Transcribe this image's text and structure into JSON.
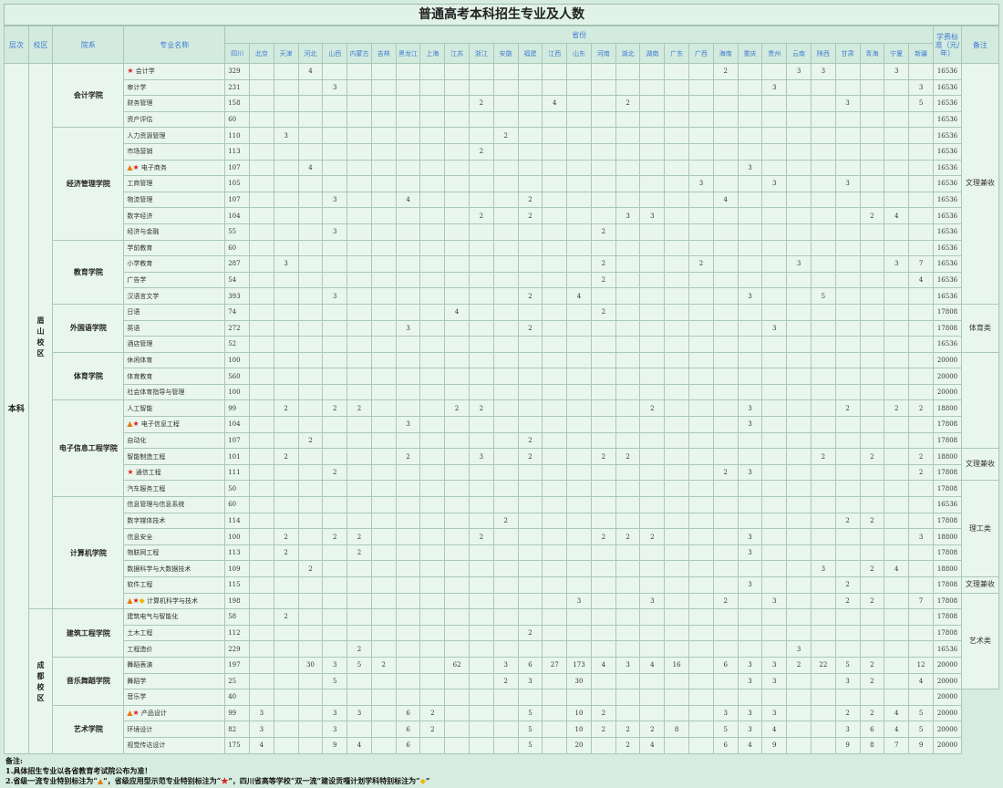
{
  "title": "普通高考本科招生专业及人数",
  "headers": {
    "level": "层次",
    "campus": "校区",
    "college": "院系",
    "major": "专业名称",
    "provinces_group": "省份",
    "fee": "学费标准（元/年）",
    "note": "备注"
  },
  "provinces": [
    "四川",
    "北京",
    "天津",
    "河北",
    "山西",
    "内蒙古",
    "吉林",
    "黑龙江",
    "上海",
    "江苏",
    "浙江",
    "安徽",
    "福建",
    "江西",
    "山东",
    "河南",
    "湖北",
    "湖南",
    "广东",
    "广西",
    "海南",
    "重庆",
    "贵州",
    "云南",
    "陕西",
    "甘肃",
    "青海",
    "宁夏",
    "新疆"
  ],
  "level_value": "本科",
  "campuses": [
    "眉山校区",
    "成都校区"
  ],
  "legend_glyphs": {
    "star": "★",
    "triangle": "▲",
    "diamond": "◆"
  },
  "colleges": [
    {
      "name": "会计学院",
      "campus": 0,
      "majors": [
        {
          "name": "会计学",
          "badges": [
            "star"
          ],
          "counts": {
            "四川": "329",
            "河北": "4",
            "海南": "2",
            "云南": "3",
            "陕西": "3",
            "宁夏": "3"
          },
          "fee": "16536"
        },
        {
          "name": "审计学",
          "badges": [],
          "counts": {
            "四川": "231",
            "山西": "3",
            "贵州": "3",
            "新疆": "3"
          },
          "fee": "16536"
        },
        {
          "name": "财务管理",
          "badges": [],
          "counts": {
            "四川": "158",
            "浙江": "2",
            "江西": "4",
            "湖北": "2",
            "甘肃": "3",
            "新疆": "5"
          },
          "fee": "16536"
        },
        {
          "name": "资产评估",
          "badges": [],
          "counts": {
            "四川": "60"
          },
          "fee": "16536"
        }
      ]
    },
    {
      "name": "经济管理学院",
      "campus": 0,
      "majors": [
        {
          "name": "人力资源管理",
          "badges": [],
          "counts": {
            "四川": "110",
            "天津": "3",
            "安徽": "2"
          },
          "fee": "16536"
        },
        {
          "name": "市场营销",
          "badges": [],
          "counts": {
            "四川": "113",
            "浙江": "2"
          },
          "fee": "16536"
        },
        {
          "name": "电子商务",
          "badges": [
            "triangle",
            "star"
          ],
          "counts": {
            "四川": "107",
            "河北": "4",
            "重庆": "3"
          },
          "fee": "16536"
        },
        {
          "name": "工商管理",
          "badges": [],
          "counts": {
            "四川": "105",
            "广西": "3",
            "贵州": "3",
            "甘肃": "3"
          },
          "fee": "16536"
        },
        {
          "name": "物流管理",
          "badges": [],
          "counts": {
            "四川": "107",
            "山西": "3",
            "黑龙江": "4",
            "福建": "2",
            "海南": "4"
          },
          "fee": "16536"
        },
        {
          "name": "数字经济",
          "badges": [],
          "counts": {
            "四川": "104",
            "浙江": "2",
            "福建": "2",
            "湖北": "3",
            "湖南": "3",
            "青海": "2",
            "宁夏": "4"
          },
          "fee": "16536"
        },
        {
          "name": "经济与金融",
          "badges": [],
          "counts": {
            "四川": "55",
            "山西": "3",
            "河南": "2"
          },
          "fee": "16536"
        }
      ]
    },
    {
      "name": "教育学院",
      "campus": 0,
      "majors": [
        {
          "name": "学前教育",
          "badges": [],
          "counts": {
            "四川": "60"
          },
          "fee": "16536"
        },
        {
          "name": "小学教育",
          "badges": [],
          "counts": {
            "四川": "287",
            "天津": "3",
            "河南": "2",
            "广西": "2",
            "云南": "3",
            "宁夏": "3",
            "新疆": "7"
          },
          "fee": "16536"
        },
        {
          "name": "广告学",
          "badges": [],
          "counts": {
            "四川": "54",
            "河南": "2",
            "新疆": "4"
          },
          "fee": "16536"
        },
        {
          "name": "汉语言文学",
          "badges": [],
          "counts": {
            "四川": "393",
            "山西": "3",
            "福建": "2",
            "山东": "4",
            "重庆": "3",
            "陕西": "5"
          },
          "fee": "16536"
        }
      ]
    },
    {
      "name": "外国语学院",
      "campus": 0,
      "majors": [
        {
          "name": "日语",
          "badges": [],
          "counts": {
            "四川": "74",
            "江苏": "4",
            "河南": "2"
          },
          "fee": "17808"
        },
        {
          "name": "英语",
          "badges": [],
          "counts": {
            "四川": "272",
            "黑龙江": "3",
            "福建": "2",
            "贵州": "3"
          },
          "fee": "17808"
        },
        {
          "name": "酒店管理",
          "badges": [],
          "counts": {
            "四川": "52"
          },
          "fee": "16536"
        }
      ]
    },
    {
      "name": "体育学院",
      "campus": 0,
      "majors": [
        {
          "name": "休闲体育",
          "badges": [],
          "counts": {
            "四川": "100"
          },
          "fee": "20000"
        },
        {
          "name": "体育教育",
          "badges": [],
          "counts": {
            "四川": "560"
          },
          "fee": "20000"
        },
        {
          "name": "社会体育指导与管理",
          "badges": [],
          "counts": {
            "四川": "100"
          },
          "fee": "20000"
        }
      ]
    },
    {
      "name": "电子信息工程学院",
      "campus": 0,
      "majors": [
        {
          "name": "人工智能",
          "badges": [],
          "counts": {
            "四川": "99",
            "天津": "2",
            "山西": "2",
            "内蒙古": "2",
            "江苏": "2",
            "浙江": "2",
            "湖南": "2",
            "重庆": "3",
            "甘肃": "2",
            "宁夏": "2",
            "新疆": "2"
          },
          "fee": "18800"
        },
        {
          "name": "电子信息工程",
          "badges": [
            "triangle",
            "star"
          ],
          "counts": {
            "四川": "104",
            "黑龙江": "3",
            "重庆": "3"
          },
          "fee": "17808"
        },
        {
          "name": "自动化",
          "badges": [],
          "counts": {
            "四川": "107",
            "河北": "2",
            "福建": "2"
          },
          "fee": "17808"
        },
        {
          "name": "智能制造工程",
          "badges": [],
          "counts": {
            "四川": "101",
            "天津": "2",
            "黑龙江": "2",
            "浙江": "3",
            "福建": "2",
            "河南": "2",
            "湖北": "2",
            "陕西": "2",
            "青海": "2",
            "新疆": "2"
          },
          "fee": "18800"
        },
        {
          "name": "通信工程",
          "badges": [
            "star"
          ],
          "counts": {
            "四川": "111",
            "山西": "2",
            "海南": "2",
            "重庆": "3",
            "新疆": "2"
          },
          "fee": "17808"
        },
        {
          "name": "汽车服务工程",
          "badges": [],
          "counts": {
            "四川": "50"
          },
          "fee": "17808"
        }
      ]
    },
    {
      "name": "计算机学院",
      "campus": 0,
      "majors": [
        {
          "name": "信息管理与信息系统",
          "badges": [],
          "counts": {
            "四川": "60"
          },
          "fee": "16536"
        },
        {
          "name": "数字媒体技术",
          "badges": [],
          "counts": {
            "四川": "114",
            "安徽": "2",
            "甘肃": "2",
            "青海": "2"
          },
          "fee": "17808"
        },
        {
          "name": "信息安全",
          "badges": [],
          "counts": {
            "四川": "100",
            "天津": "2",
            "山西": "2",
            "内蒙古": "2",
            "浙江": "2",
            "河南": "2",
            "湖北": "2",
            "湖南": "2",
            "重庆": "3",
            "新疆": "3"
          },
          "fee": "18800"
        },
        {
          "name": "物联网工程",
          "badges": [],
          "counts": {
            "四川": "113",
            "天津": "2",
            "内蒙古": "2",
            "重庆": "3"
          },
          "fee": "17808"
        },
        {
          "name": "数据科学与大数据技术",
          "badges": [],
          "counts": {
            "四川": "109",
            "河北": "2",
            "陕西": "3",
            "青海": "2",
            "宁夏": "4"
          },
          "fee": "18800"
        },
        {
          "name": "软件工程",
          "badges": [],
          "counts": {
            "四川": "115",
            "重庆": "3",
            "甘肃": "2"
          },
          "fee": "17808"
        },
        {
          "name": "计算机科学与技术",
          "badges": [
            "triangle",
            "star",
            "diamond"
          ],
          "counts": {
            "四川": "198",
            "山东": "3",
            "湖南": "3",
            "海南": "2",
            "贵州": "3",
            "甘肃": "2",
            "青海": "2",
            "新疆": "7"
          },
          "fee": "17808"
        }
      ]
    },
    {
      "name": "建筑工程学院",
      "campus": 1,
      "majors": [
        {
          "name": "建筑电气与智能化",
          "badges": [],
          "counts": {
            "四川": "58",
            "天津": "2"
          },
          "fee": "17808"
        },
        {
          "name": "土木工程",
          "badges": [],
          "counts": {
            "四川": "112",
            "福建": "2"
          },
          "fee": "17808"
        },
        {
          "name": "工程造价",
          "badges": [],
          "counts": {
            "四川": "229",
            "内蒙古": "2",
            "云南": "3"
          },
          "fee": "16536"
        }
      ]
    },
    {
      "name": "音乐舞蹈学院",
      "campus": 1,
      "majors": [
        {
          "name": "舞蹈表演",
          "badges": [],
          "counts": {
            "四川": "197",
            "河北": "30",
            "山西": "3",
            "内蒙古": "5",
            "吉林": "2",
            "江苏": "62",
            "安徽": "3",
            "福建": "6",
            "江西": "27",
            "山东": "173",
            "河南": "4",
            "湖北": "3",
            "湖南": "4",
            "广东": "16",
            "海南": "6",
            "重庆": "3",
            "贵州": "3",
            "云南": "2",
            "陕西": "22",
            "甘肃": "5",
            "青海": "2",
            "新疆": "12"
          },
          "fee": "20000"
        },
        {
          "name": "舞蹈学",
          "badges": [],
          "counts": {
            "四川": "25",
            "山西": "5",
            "安徽": "2",
            "福建": "3",
            "山东": "30",
            "重庆": "3",
            "贵州": "3",
            "甘肃": "3",
            "青海": "2",
            "新疆": "4"
          },
          "fee": "20000"
        },
        {
          "name": "音乐学",
          "badges": [],
          "counts": {
            "四川": "40"
          },
          "fee": "20000"
        }
      ]
    },
    {
      "name": "艺术学院",
      "campus": 1,
      "majors": [
        {
          "name": "产品设计",
          "badges": [
            "triangle",
            "star"
          ],
          "counts": {
            "四川": "99",
            "北京": "3",
            "山西": "3",
            "内蒙古": "3",
            "黑龙江": "6",
            "上海": "2",
            "福建": "5",
            "山东": "10",
            "河南": "2",
            "海南": "3",
            "重庆": "3",
            "贵州": "3",
            "甘肃": "2",
            "青海": "2",
            "宁夏": "4",
            "新疆": "5"
          },
          "fee": "20000"
        },
        {
          "name": "环境设计",
          "badges": [],
          "counts": {
            "四川": "82",
            "北京": "3",
            "山西": "3",
            "黑龙江": "6",
            "上海": "2",
            "福建": "5",
            "山东": "10",
            "河南": "2",
            "湖北": "2",
            "湖南": "2",
            "广东": "8",
            "海南": "5",
            "重庆": "3",
            "贵州": "4",
            "甘肃": "3",
            "青海": "6",
            "宁夏": "4",
            "新疆": "5"
          },
          "fee": "20000"
        },
        {
          "name": "视觉传达设计",
          "badges": [],
          "counts": {
            "四川": "175",
            "北京": "4",
            "山西": "9",
            "内蒙古": "4",
            "黑龙江": "6",
            "福建": "5",
            "山东": "20",
            "湖北": "2",
            "湖南": "4",
            "海南": "6",
            "重庆": "4",
            "贵州": "9",
            "甘肃": "9",
            "青海": "8",
            "宁夏": "7",
            "新疆": "9"
          },
          "fee": "20000"
        }
      ]
    }
  ],
  "notes": [
    {
      "text": "文理兼收",
      "rows": [
        0,
        14
      ]
    },
    {
      "text": "体育类",
      "rows": [
        15,
        17
      ]
    },
    {
      "text": "",
      "rows": [
        18,
        23
      ]
    },
    {
      "text": "文理兼收",
      "rows": [
        24,
        25
      ]
    },
    {
      "text": "理工类",
      "rows": [
        26,
        31
      ]
    },
    {
      "text": "文理兼收",
      "rows": [
        32,
        32
      ]
    },
    {
      "text": "艺术类",
      "rows": [
        33,
        38
      ]
    }
  ],
  "footer": {
    "heading": "备注:",
    "line1": "1.具体招生专业以各省教育考试院公布为准！",
    "line2_a": "2.省级一流专业特别标注为“",
    "line2_b": "”，省级应用型示范专业特别标注为“",
    "line2_c": "”，四川省高等学校“双一流”建设贡嘎计划学科特别标注为“",
    "line2_d": "”"
  }
}
